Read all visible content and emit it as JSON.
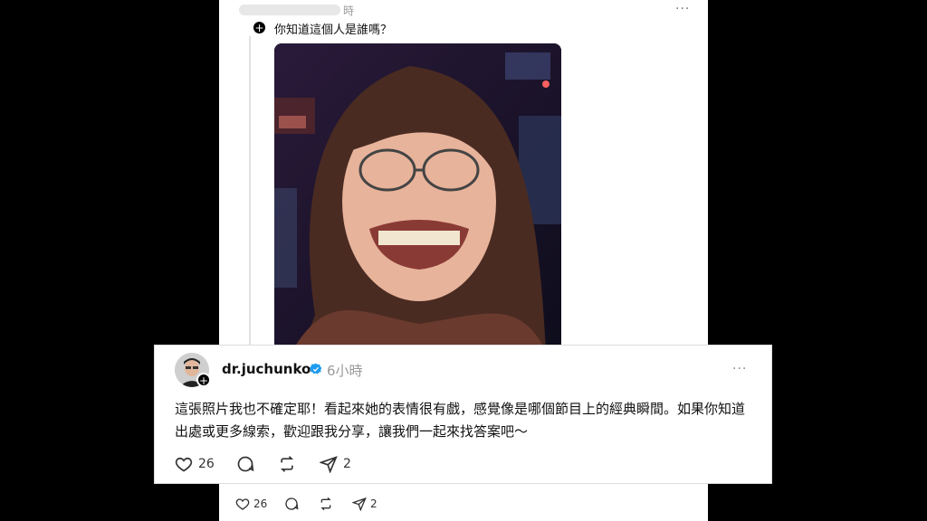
{
  "top_post": {
    "time": "時",
    "more": "···",
    "question": "你知道這個人是誰嗎？",
    "plus": "+"
  },
  "reply": {
    "username": "dr.juchunko",
    "time_ago": "6小時",
    "more": "···",
    "plus": "+",
    "text": "這張照片我也不確定耶！看起來她的表情很有戲，感覺像是哪個節目上的經典瞬間。如果你知道出處或更多線索，歡迎跟我分享，讓我們一起來找答案吧～",
    "likes": "26",
    "shares": "2"
  },
  "bottom_bar": {
    "likes": "26",
    "shares": "2"
  },
  "colors": {
    "verified": "#1d9bf0",
    "background": "#000000"
  },
  "icons": [
    "heart-icon",
    "comment-icon",
    "repost-icon",
    "share-icon",
    "more-icon",
    "verified-icon",
    "plus-icon"
  ]
}
